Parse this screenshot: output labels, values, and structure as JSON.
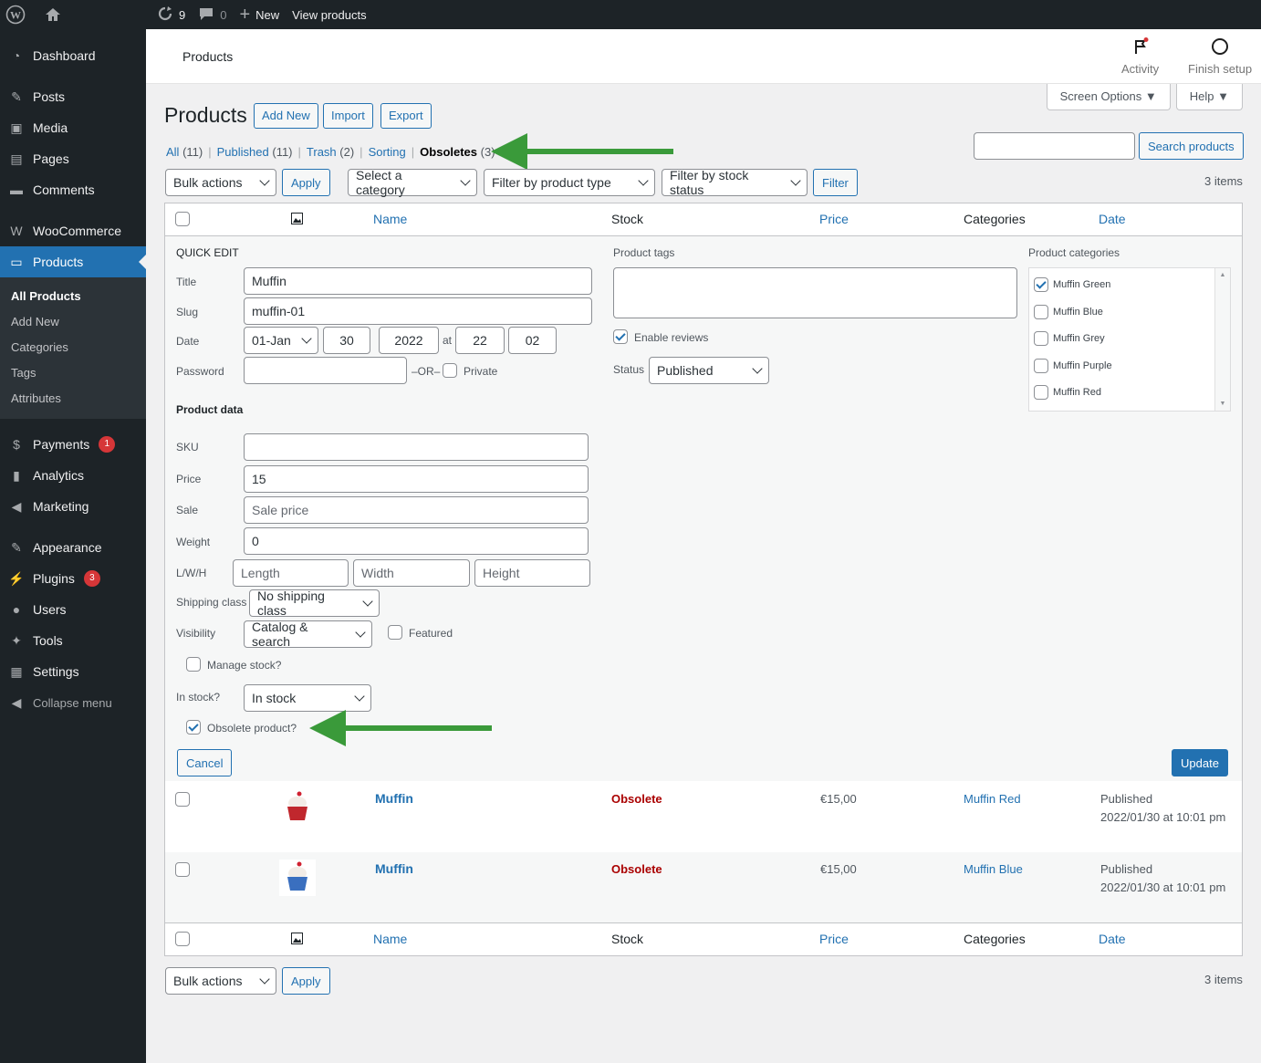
{
  "admin_bar": {
    "updates_count": "9",
    "comments_count": "0",
    "new_label": "New",
    "view_label": "View products"
  },
  "sidebar": {
    "items": [
      {
        "label": "Dashboard",
        "icon": "dashboard-icon"
      },
      {
        "label": "Posts",
        "icon": "pin-icon"
      },
      {
        "label": "Media",
        "icon": "media-icon"
      },
      {
        "label": "Pages",
        "icon": "pages-icon"
      },
      {
        "label": "Comments",
        "icon": "comment-icon"
      },
      {
        "label": "WooCommerce",
        "icon": "woo-icon"
      },
      {
        "label": "Products",
        "icon": "archive-icon"
      },
      {
        "label": "Payments",
        "icon": "payments-icon",
        "badge": "1"
      },
      {
        "label": "Analytics",
        "icon": "chart-icon"
      },
      {
        "label": "Marketing",
        "icon": "megaphone-icon"
      },
      {
        "label": "Appearance",
        "icon": "brush-icon"
      },
      {
        "label": "Plugins",
        "icon": "plug-icon",
        "badge": "3"
      },
      {
        "label": "Users",
        "icon": "user-icon"
      },
      {
        "label": "Tools",
        "icon": "wrench-icon"
      },
      {
        "label": "Settings",
        "icon": "settings-icon"
      },
      {
        "label": "Collapse menu",
        "icon": "collapse-icon"
      }
    ],
    "submenu": [
      "All Products",
      "Add New",
      "Categories",
      "Tags",
      "Attributes"
    ]
  },
  "topbar": {
    "crumb": "Products",
    "activity": "Activity",
    "finish_setup": "Finish setup"
  },
  "screen_options": "Screen Options",
  "help": "Help",
  "page": {
    "title": "Products",
    "add_new": "Add New",
    "import": "Import",
    "export": "Export"
  },
  "views": {
    "all": "All",
    "all_count": "(11)",
    "published": "Published",
    "published_count": "(11)",
    "trash": "Trash",
    "trash_count": "(2)",
    "sorting": "Sorting",
    "obsoletes": "Obsoletes",
    "obsoletes_count": "(3)"
  },
  "search": {
    "button": "Search products",
    "value": ""
  },
  "filters": {
    "bulk_actions": "Bulk actions",
    "apply": "Apply",
    "category": "Select a category",
    "product_type": "Filter by product type",
    "stock_status": "Filter by stock status",
    "filter": "Filter",
    "items_count": "3 items"
  },
  "columns": {
    "name": "Name",
    "stock": "Stock",
    "price": "Price",
    "categories": "Categories",
    "date": "Date"
  },
  "quick_edit": {
    "heading": "QUICK EDIT",
    "title_label": "Title",
    "title_value": "Muffin",
    "slug_label": "Slug",
    "slug_value": "muffin-01",
    "date_label": "Date",
    "month": "01-Jan",
    "day": "30",
    "year": "2022",
    "at": "at",
    "hour": "22",
    "minute": "02",
    "password_label": "Password",
    "or": "–OR–",
    "private": "Private",
    "product_data": "Product data",
    "sku_label": "SKU",
    "sku_value": "",
    "price_label": "Price",
    "price_value": "15",
    "sale_label": "Sale",
    "sale_placeholder": "Sale price",
    "weight_label": "Weight",
    "weight_value": "0",
    "lwh_label": "L/W/H",
    "length": "Length",
    "width": "Width",
    "height": "Height",
    "shipping_label": "Shipping class",
    "shipping_value": "No shipping class",
    "visibility_label": "Visibility",
    "visibility_value": "Catalog & search",
    "featured": "Featured",
    "manage_stock": "Manage stock?",
    "in_stock_label": "In stock?",
    "in_stock_value": "In stock",
    "obsolete": "Obsolete product?",
    "cancel": "Cancel",
    "update": "Update",
    "tags_label": "Product tags",
    "enable_reviews": "Enable reviews",
    "status_label": "Status",
    "status_value": "Published",
    "categories_label": "Product categories",
    "categories": [
      {
        "name": "Muffin Green",
        "checked": true
      },
      {
        "name": "Muffin Blue",
        "checked": false
      },
      {
        "name": "Muffin Grey",
        "checked": false
      },
      {
        "name": "Muffin Purple",
        "checked": false
      },
      {
        "name": "Muffin Red",
        "checked": false
      }
    ]
  },
  "rows": [
    {
      "name": "Muffin",
      "stock": "Obsolete",
      "price": "€15,00",
      "category": "Muffin Red",
      "status": "Published",
      "date": "2022/01/30 at 10:01 pm",
      "thumb_color": "#c0272d"
    },
    {
      "name": "Muffin",
      "stock": "Obsolete",
      "price": "€15,00",
      "category": "Muffin Blue",
      "status": "Published",
      "date": "2022/01/30 at 10:01 pm",
      "thumb_color": "#3a6fbf"
    }
  ]
}
